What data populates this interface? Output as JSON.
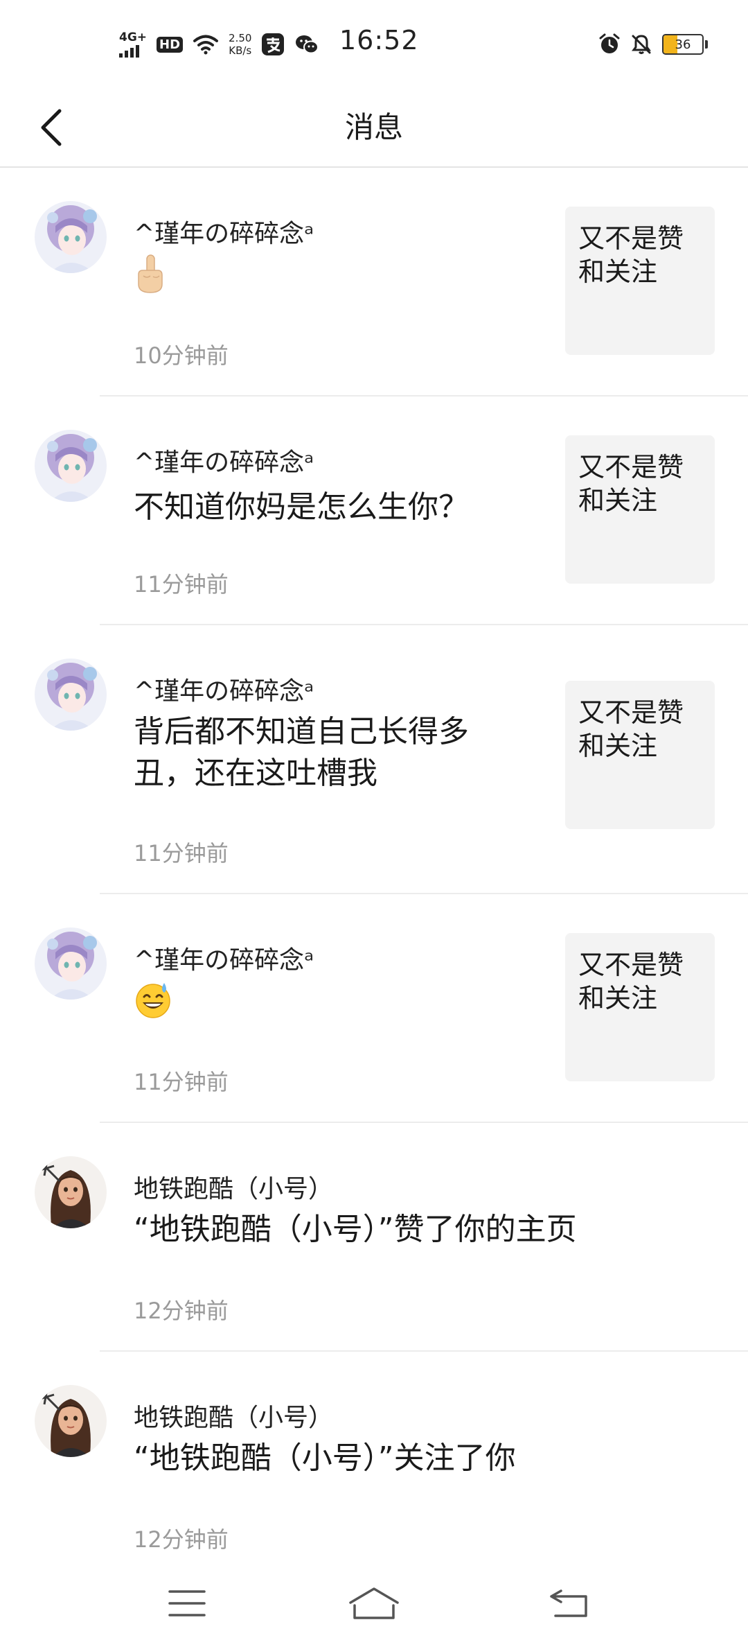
{
  "status_bar": {
    "network": "4G+",
    "hd": "HD",
    "speed_value": "2.50",
    "speed_unit": "KB/s",
    "time": "16:52",
    "battery": "36",
    "battery_level": 0.36,
    "icons": [
      "signal-icon",
      "wifi-icon",
      "alipay-icon",
      "wechat-icon",
      "alarm-icon",
      "mute-icon",
      "battery-icon"
    ]
  },
  "header": {
    "title": "消息",
    "back_icon": "chevron-left-icon"
  },
  "messages": [
    {
      "name": "^瑾年の碎碎念ᵃ",
      "content": "",
      "content_emoji": "middle-finger-emoji",
      "time": "10分钟前",
      "ref": "又不是赞和关注",
      "avatar": "anime-girl-lavender-avatar"
    },
    {
      "name": "^瑾年の碎碎念ᵃ",
      "content": "不知道你妈是怎么生你？",
      "time": "11分钟前",
      "ref": "又不是赞和关注",
      "avatar": "anime-girl-lavender-avatar"
    },
    {
      "name": "^瑾年の碎碎念ᵃ",
      "content": "背后都不知道自己长得多丑，还在这吐槽我",
      "time": "11分钟前",
      "ref": "又不是赞和关注",
      "avatar": "anime-girl-lavender-avatar"
    },
    {
      "name": "^瑾年の碎碎念ᵃ",
      "content": "",
      "content_emoji": "sweat-smile-emoji",
      "time": "11分钟前",
      "ref": "又不是赞和关注",
      "avatar": "anime-girl-lavender-avatar"
    },
    {
      "name": "地铁跑酷（小号）",
      "content": "“地铁跑酷（小号）”赞了你的主页",
      "time": "12分钟前",
      "avatar": "archer-girl-avatar"
    },
    {
      "name": "地铁跑酷（小号）",
      "content": "“地铁跑酷（小号）”关注了你",
      "time": "12分钟前",
      "avatar": "archer-girl-avatar"
    }
  ],
  "nav_bar": {
    "icons": [
      "menu-icon",
      "home-icon",
      "back-icon"
    ]
  },
  "colors": {
    "background": "#ffffff",
    "divider": "#ececec",
    "time_text": "#9a9a9a",
    "ref_box": "#f3f3f3",
    "battery": "#f2b41c"
  }
}
